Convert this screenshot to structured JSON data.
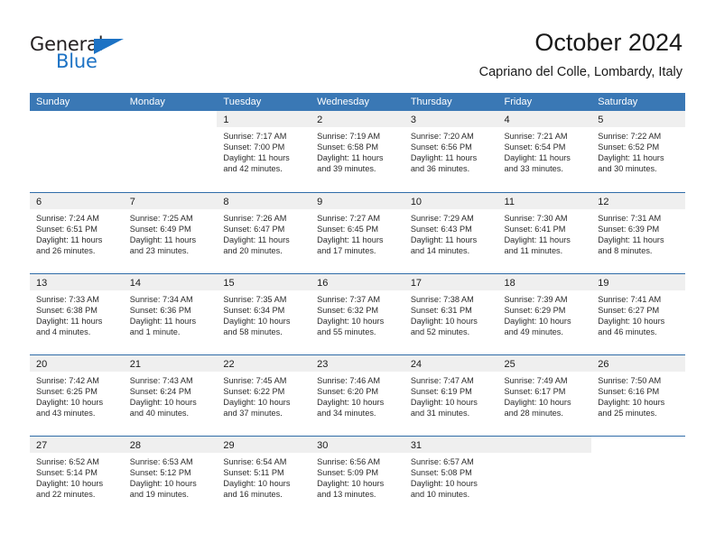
{
  "brand": {
    "name_top": "General",
    "name_bottom": "Blue",
    "color_primary": "#1c72c4",
    "color_dark": "#231f20"
  },
  "header": {
    "title": "October 2024",
    "subtitle": "Capriano del Colle, Lombardy, Italy"
  },
  "calendar": {
    "header_bg": "#3a78b5",
    "row_divider": "#2f6ca8",
    "daynum_band_bg": "#efefef",
    "weekdays": [
      "Sunday",
      "Monday",
      "Tuesday",
      "Wednesday",
      "Thursday",
      "Friday",
      "Saturday"
    ],
    "weeks": [
      [
        {
          "day": "",
          "sunrise": "",
          "sunset": "",
          "daylight_1": "",
          "daylight_2": "",
          "band": false
        },
        {
          "day": "",
          "sunrise": "",
          "sunset": "",
          "daylight_1": "",
          "daylight_2": "",
          "band": false
        },
        {
          "day": "1",
          "sunrise": "Sunrise: 7:17 AM",
          "sunset": "Sunset: 7:00 PM",
          "daylight_1": "Daylight: 11 hours",
          "daylight_2": "and 42 minutes.",
          "band": true
        },
        {
          "day": "2",
          "sunrise": "Sunrise: 7:19 AM",
          "sunset": "Sunset: 6:58 PM",
          "daylight_1": "Daylight: 11 hours",
          "daylight_2": "and 39 minutes.",
          "band": true
        },
        {
          "day": "3",
          "sunrise": "Sunrise: 7:20 AM",
          "sunset": "Sunset: 6:56 PM",
          "daylight_1": "Daylight: 11 hours",
          "daylight_2": "and 36 minutes.",
          "band": true
        },
        {
          "day": "4",
          "sunrise": "Sunrise: 7:21 AM",
          "sunset": "Sunset: 6:54 PM",
          "daylight_1": "Daylight: 11 hours",
          "daylight_2": "and 33 minutes.",
          "band": true
        },
        {
          "day": "5",
          "sunrise": "Sunrise: 7:22 AM",
          "sunset": "Sunset: 6:52 PM",
          "daylight_1": "Daylight: 11 hours",
          "daylight_2": "and 30 minutes.",
          "band": true
        }
      ],
      [
        {
          "day": "6",
          "sunrise": "Sunrise: 7:24 AM",
          "sunset": "Sunset: 6:51 PM",
          "daylight_1": "Daylight: 11 hours",
          "daylight_2": "and 26 minutes.",
          "band": true
        },
        {
          "day": "7",
          "sunrise": "Sunrise: 7:25 AM",
          "sunset": "Sunset: 6:49 PM",
          "daylight_1": "Daylight: 11 hours",
          "daylight_2": "and 23 minutes.",
          "band": true
        },
        {
          "day": "8",
          "sunrise": "Sunrise: 7:26 AM",
          "sunset": "Sunset: 6:47 PM",
          "daylight_1": "Daylight: 11 hours",
          "daylight_2": "and 20 minutes.",
          "band": true
        },
        {
          "day": "9",
          "sunrise": "Sunrise: 7:27 AM",
          "sunset": "Sunset: 6:45 PM",
          "daylight_1": "Daylight: 11 hours",
          "daylight_2": "and 17 minutes.",
          "band": true
        },
        {
          "day": "10",
          "sunrise": "Sunrise: 7:29 AM",
          "sunset": "Sunset: 6:43 PM",
          "daylight_1": "Daylight: 11 hours",
          "daylight_2": "and 14 minutes.",
          "band": true
        },
        {
          "day": "11",
          "sunrise": "Sunrise: 7:30 AM",
          "sunset": "Sunset: 6:41 PM",
          "daylight_1": "Daylight: 11 hours",
          "daylight_2": "and 11 minutes.",
          "band": true
        },
        {
          "day": "12",
          "sunrise": "Sunrise: 7:31 AM",
          "sunset": "Sunset: 6:39 PM",
          "daylight_1": "Daylight: 11 hours",
          "daylight_2": "and 8 minutes.",
          "band": true
        }
      ],
      [
        {
          "day": "13",
          "sunrise": "Sunrise: 7:33 AM",
          "sunset": "Sunset: 6:38 PM",
          "daylight_1": "Daylight: 11 hours",
          "daylight_2": "and 4 minutes.",
          "band": true
        },
        {
          "day": "14",
          "sunrise": "Sunrise: 7:34 AM",
          "sunset": "Sunset: 6:36 PM",
          "daylight_1": "Daylight: 11 hours",
          "daylight_2": "and 1 minute.",
          "band": true
        },
        {
          "day": "15",
          "sunrise": "Sunrise: 7:35 AM",
          "sunset": "Sunset: 6:34 PM",
          "daylight_1": "Daylight: 10 hours",
          "daylight_2": "and 58 minutes.",
          "band": true
        },
        {
          "day": "16",
          "sunrise": "Sunrise: 7:37 AM",
          "sunset": "Sunset: 6:32 PM",
          "daylight_1": "Daylight: 10 hours",
          "daylight_2": "and 55 minutes.",
          "band": true
        },
        {
          "day": "17",
          "sunrise": "Sunrise: 7:38 AM",
          "sunset": "Sunset: 6:31 PM",
          "daylight_1": "Daylight: 10 hours",
          "daylight_2": "and 52 minutes.",
          "band": true
        },
        {
          "day": "18",
          "sunrise": "Sunrise: 7:39 AM",
          "sunset": "Sunset: 6:29 PM",
          "daylight_1": "Daylight: 10 hours",
          "daylight_2": "and 49 minutes.",
          "band": true
        },
        {
          "day": "19",
          "sunrise": "Sunrise: 7:41 AM",
          "sunset": "Sunset: 6:27 PM",
          "daylight_1": "Daylight: 10 hours",
          "daylight_2": "and 46 minutes.",
          "band": true
        }
      ],
      [
        {
          "day": "20",
          "sunrise": "Sunrise: 7:42 AM",
          "sunset": "Sunset: 6:25 PM",
          "daylight_1": "Daylight: 10 hours",
          "daylight_2": "and 43 minutes.",
          "band": true
        },
        {
          "day": "21",
          "sunrise": "Sunrise: 7:43 AM",
          "sunset": "Sunset: 6:24 PM",
          "daylight_1": "Daylight: 10 hours",
          "daylight_2": "and 40 minutes.",
          "band": true
        },
        {
          "day": "22",
          "sunrise": "Sunrise: 7:45 AM",
          "sunset": "Sunset: 6:22 PM",
          "daylight_1": "Daylight: 10 hours",
          "daylight_2": "and 37 minutes.",
          "band": true
        },
        {
          "day": "23",
          "sunrise": "Sunrise: 7:46 AM",
          "sunset": "Sunset: 6:20 PM",
          "daylight_1": "Daylight: 10 hours",
          "daylight_2": "and 34 minutes.",
          "band": true
        },
        {
          "day": "24",
          "sunrise": "Sunrise: 7:47 AM",
          "sunset": "Sunset: 6:19 PM",
          "daylight_1": "Daylight: 10 hours",
          "daylight_2": "and 31 minutes.",
          "band": true
        },
        {
          "day": "25",
          "sunrise": "Sunrise: 7:49 AM",
          "sunset": "Sunset: 6:17 PM",
          "daylight_1": "Daylight: 10 hours",
          "daylight_2": "and 28 minutes.",
          "band": true
        },
        {
          "day": "26",
          "sunrise": "Sunrise: 7:50 AM",
          "sunset": "Sunset: 6:16 PM",
          "daylight_1": "Daylight: 10 hours",
          "daylight_2": "and 25 minutes.",
          "band": true
        }
      ],
      [
        {
          "day": "27",
          "sunrise": "Sunrise: 6:52 AM",
          "sunset": "Sunset: 5:14 PM",
          "daylight_1": "Daylight: 10 hours",
          "daylight_2": "and 22 minutes.",
          "band": true
        },
        {
          "day": "28",
          "sunrise": "Sunrise: 6:53 AM",
          "sunset": "Sunset: 5:12 PM",
          "daylight_1": "Daylight: 10 hours",
          "daylight_2": "and 19 minutes.",
          "band": true
        },
        {
          "day": "29",
          "sunrise": "Sunrise: 6:54 AM",
          "sunset": "Sunset: 5:11 PM",
          "daylight_1": "Daylight: 10 hours",
          "daylight_2": "and 16 minutes.",
          "band": true
        },
        {
          "day": "30",
          "sunrise": "Sunrise: 6:56 AM",
          "sunset": "Sunset: 5:09 PM",
          "daylight_1": "Daylight: 10 hours",
          "daylight_2": "and 13 minutes.",
          "band": true
        },
        {
          "day": "31",
          "sunrise": "Sunrise: 6:57 AM",
          "sunset": "Sunset: 5:08 PM",
          "daylight_1": "Daylight: 10 hours",
          "daylight_2": "and 10 minutes.",
          "band": true
        },
        {
          "day": "",
          "sunrise": "",
          "sunset": "",
          "daylight_1": "",
          "daylight_2": "",
          "band": true
        },
        {
          "day": "",
          "sunrise": "",
          "sunset": "",
          "daylight_1": "",
          "daylight_2": "",
          "band": false
        }
      ]
    ]
  }
}
